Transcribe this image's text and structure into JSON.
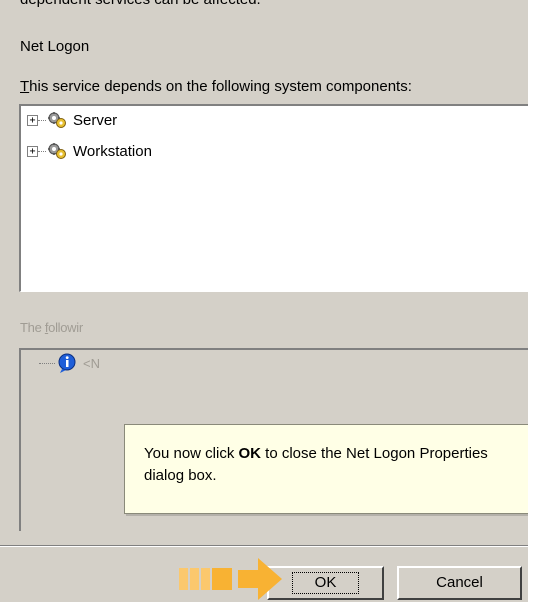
{
  "top_cut_text": "dependent services can be affected.",
  "service_name": "Net Logon",
  "depends_label": {
    "mnemonic": "T",
    "rest": "his service depends on the following system components:"
  },
  "depends_tree": [
    {
      "label": "Server",
      "icon": "service-gear-icon",
      "expander": "+"
    },
    {
      "label": "Workstation",
      "icon": "service-gear-icon",
      "expander": "+"
    }
  ],
  "dependents_label": {
    "before": "The ",
    "mnemonic": "f",
    "rest": "ollowir"
  },
  "dependents_tree": [
    {
      "label": "<N",
      "icon": "info-icon"
    }
  ],
  "callout": {
    "text_before": "You now click ",
    "text_bold": "OK",
    "text_after": " to close the Net Logon Properties dialog box."
  },
  "buttons": {
    "ok": "OK",
    "cancel": "Cancel"
  },
  "colors": {
    "dialog_bg": "#d4d0c8",
    "callout_bg": "#ffffe6",
    "pointer": "#f8b233"
  }
}
